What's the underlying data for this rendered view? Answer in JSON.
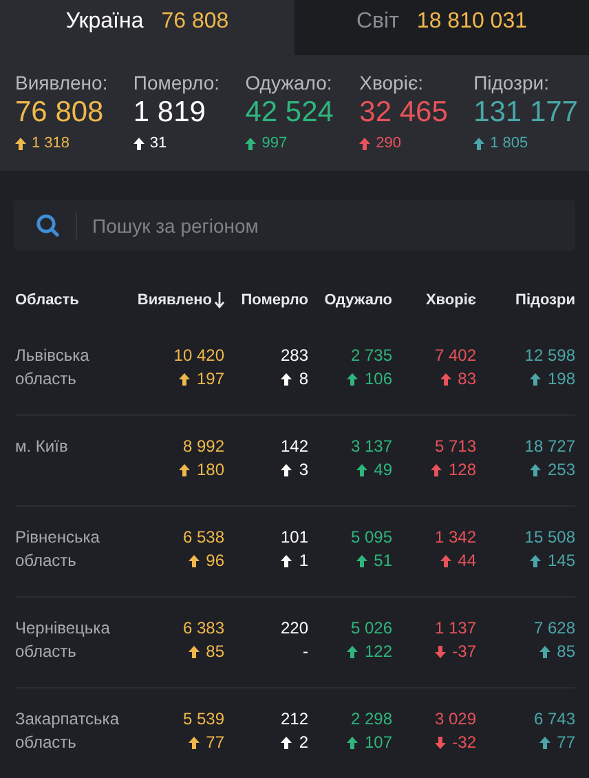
{
  "tabs": [
    {
      "label": "Україна",
      "value": "76 808",
      "selected": true
    },
    {
      "label": "Світ",
      "value": "18 810 031",
      "selected": false
    }
  ],
  "summary": [
    {
      "label": "Виявлено:",
      "value": "76 808",
      "delta": "1 318",
      "color": "#f0b84a"
    },
    {
      "label": "Померло:",
      "value": "1 819",
      "delta": "31",
      "color": "#ffffff"
    },
    {
      "label": "Одужало:",
      "value": "42 524",
      "delta": "997",
      "color": "#2eb67d"
    },
    {
      "label": "Хворіє:",
      "value": "32 465",
      "delta": "290",
      "color": "#e8525a"
    },
    {
      "label": "Підозри:",
      "value": "131 177",
      "delta": "1 805",
      "color": "#4aa6a9"
    }
  ],
  "search": {
    "placeholder": "Пошук за регіоном"
  },
  "table": {
    "columns": [
      {
        "label": "Область",
        "sorted": false
      },
      {
        "label": "Виявлено",
        "sorted": true
      },
      {
        "label": "Померло",
        "sorted": false
      },
      {
        "label": "Одужало",
        "sorted": false
      },
      {
        "label": "Хворіє",
        "sorted": false
      },
      {
        "label": "Підозри",
        "sorted": false
      }
    ],
    "rows": [
      {
        "cells": [
          {
            "value": "Львівська область"
          },
          {
            "value": "10 420",
            "delta": "197",
            "rising": true
          },
          {
            "value": "283",
            "delta": "8",
            "rising": true
          },
          {
            "value": "2 735",
            "delta": "106",
            "rising": true
          },
          {
            "value": "7 402",
            "delta": "83",
            "rising": true
          },
          {
            "value": "12 598",
            "delta": "198",
            "rising": true
          }
        ]
      },
      {
        "cells": [
          {
            "value": "м. Київ"
          },
          {
            "value": "8 992",
            "delta": "180",
            "rising": true
          },
          {
            "value": "142",
            "delta": "3",
            "rising": true
          },
          {
            "value": "3 137",
            "delta": "49",
            "rising": true
          },
          {
            "value": "5 713",
            "delta": "128",
            "rising": true
          },
          {
            "value": "18 727",
            "delta": "253",
            "rising": true
          }
        ]
      },
      {
        "cells": [
          {
            "value": "Рівненська область"
          },
          {
            "value": "6 538",
            "delta": "96",
            "rising": true
          },
          {
            "value": "101",
            "delta": "1",
            "rising": true
          },
          {
            "value": "5 095",
            "delta": "51",
            "rising": true
          },
          {
            "value": "1 342",
            "delta": "44",
            "rising": true
          },
          {
            "value": "15 508",
            "delta": "145",
            "rising": true
          }
        ]
      },
      {
        "cells": [
          {
            "value": "Чернівецька область"
          },
          {
            "value": "6 383",
            "delta": "85",
            "rising": true
          },
          {
            "value": "220",
            "delta": "-"
          },
          {
            "value": "5 026",
            "delta": "122",
            "rising": true
          },
          {
            "value": "1 137",
            "delta": "-37",
            "rising": false
          },
          {
            "value": "7 628",
            "delta": "85",
            "rising": true
          }
        ]
      },
      {
        "cells": [
          {
            "value": "Закарпатська область"
          },
          {
            "value": "5 539",
            "delta": "77",
            "rising": true
          },
          {
            "value": "212",
            "delta": "2",
            "rising": true
          },
          {
            "value": "2 298",
            "delta": "107",
            "rising": true
          },
          {
            "value": "3 029",
            "delta": "-32",
            "rising": false
          },
          {
            "value": "6 743",
            "delta": "77",
            "rising": true
          }
        ]
      }
    ]
  }
}
